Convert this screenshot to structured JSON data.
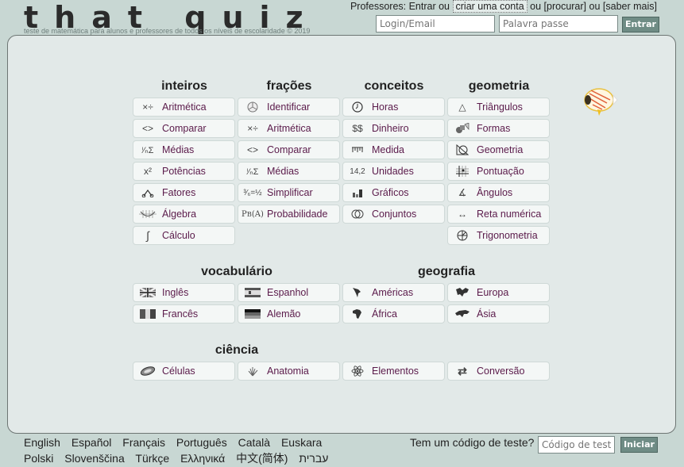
{
  "header": {
    "logo": "that quiz",
    "tagline": "teste de matemática para alunos e professores de todos os níveis de escolaridade © 2019",
    "teachers_prefix": "Professores: Entrar ou",
    "create_account": "criar uma conta",
    "sep1": "ou",
    "search": "[procurar]",
    "sep2": "ou",
    "learn_more": "[saber mais]",
    "login_placeholder": "Login/Email",
    "password_placeholder": "Palavra passe",
    "login_button": "Entrar"
  },
  "sections": {
    "inteiros": {
      "title": "inteiros",
      "items": [
        {
          "label": "Aritmética",
          "icon": "arithmetic-icon"
        },
        {
          "label": "Comparar",
          "icon": "compare-icon"
        },
        {
          "label": "Médias",
          "icon": "mean-icon"
        },
        {
          "label": "Potências",
          "icon": "power-icon"
        },
        {
          "label": "Fatores",
          "icon": "factor-tree-icon"
        },
        {
          "label": "Álgebra",
          "icon": "algebra-icon"
        },
        {
          "label": "Cálculo",
          "icon": "integral-icon"
        }
      ]
    },
    "fracoes": {
      "title": "frações",
      "items": [
        {
          "label": "Identificar",
          "icon": "pie-fraction-icon"
        },
        {
          "label": "Aritmética",
          "icon": "arithmetic-icon"
        },
        {
          "label": "Comparar",
          "icon": "compare-icon"
        },
        {
          "label": "Médias",
          "icon": "mean-icon"
        },
        {
          "label": "Simplificar",
          "icon": "simplify-fraction-icon"
        },
        {
          "label": "Probabilidade",
          "icon": "probability-icon"
        }
      ]
    },
    "conceitos": {
      "title": "conceitos",
      "items": [
        {
          "label": "Horas",
          "icon": "clock-icon"
        },
        {
          "label": "Dinheiro",
          "icon": "money-icon"
        },
        {
          "label": "Medida",
          "icon": "ruler-icon"
        },
        {
          "label": "Unidades",
          "icon": "units-icon"
        },
        {
          "label": "Gráficos",
          "icon": "bar-chart-icon"
        },
        {
          "label": "Conjuntos",
          "icon": "venn-icon"
        }
      ]
    },
    "geometria": {
      "title": "geometria",
      "items": [
        {
          "label": "Triângulos",
          "icon": "triangle-icon"
        },
        {
          "label": "Formas",
          "icon": "shapes-icon"
        },
        {
          "label": "Geometria",
          "icon": "geometry-icon"
        },
        {
          "label": "Pontuação",
          "icon": "grid-point-icon"
        },
        {
          "label": "Ângulos",
          "icon": "angle-icon"
        },
        {
          "label": "Reta numérica",
          "icon": "number-line-icon"
        },
        {
          "label": "Trigonometria",
          "icon": "unit-circle-icon"
        }
      ]
    },
    "vocabulario": {
      "title": "vocabulário",
      "items": [
        {
          "label": "Inglês",
          "icon": "uk-flag-icon"
        },
        {
          "label": "Espanhol",
          "icon": "spain-flag-icon"
        },
        {
          "label": "Francês",
          "icon": "france-flag-icon"
        },
        {
          "label": "Alemão",
          "icon": "germany-flag-icon"
        }
      ]
    },
    "geografia": {
      "title": "geografia",
      "items": [
        {
          "label": "Américas",
          "icon": "americas-map-icon"
        },
        {
          "label": "Europa",
          "icon": "europe-map-icon"
        },
        {
          "label": "África",
          "icon": "africa-map-icon"
        },
        {
          "label": "Ásia",
          "icon": "asia-map-icon"
        }
      ]
    },
    "ciencia": {
      "title": "ciência",
      "items": [
        {
          "label": "Células",
          "icon": "cell-icon"
        },
        {
          "label": "Anatomia",
          "icon": "hand-bones-icon"
        },
        {
          "label": "Elementos",
          "icon": "atom-icon"
        },
        {
          "label": "Conversão",
          "icon": "convert-arrows-icon"
        }
      ]
    }
  },
  "footer": {
    "languages_row1": [
      "English",
      "Español",
      "Français",
      "Português",
      "Català",
      "Euskara"
    ],
    "languages_row2": [
      "Polski",
      "Slovenščina",
      "Türkçe",
      "Ελληνικά",
      "中文(简体)",
      "עברית"
    ],
    "code_label": "Tem um código de teste?",
    "code_placeholder": "Código de teste",
    "start_button": "Iniciar"
  },
  "colors": {
    "background": "#c8d7d3",
    "panel": "#e2e9e8",
    "link_text": "#5a1a4a",
    "button": "#6f8c85"
  }
}
